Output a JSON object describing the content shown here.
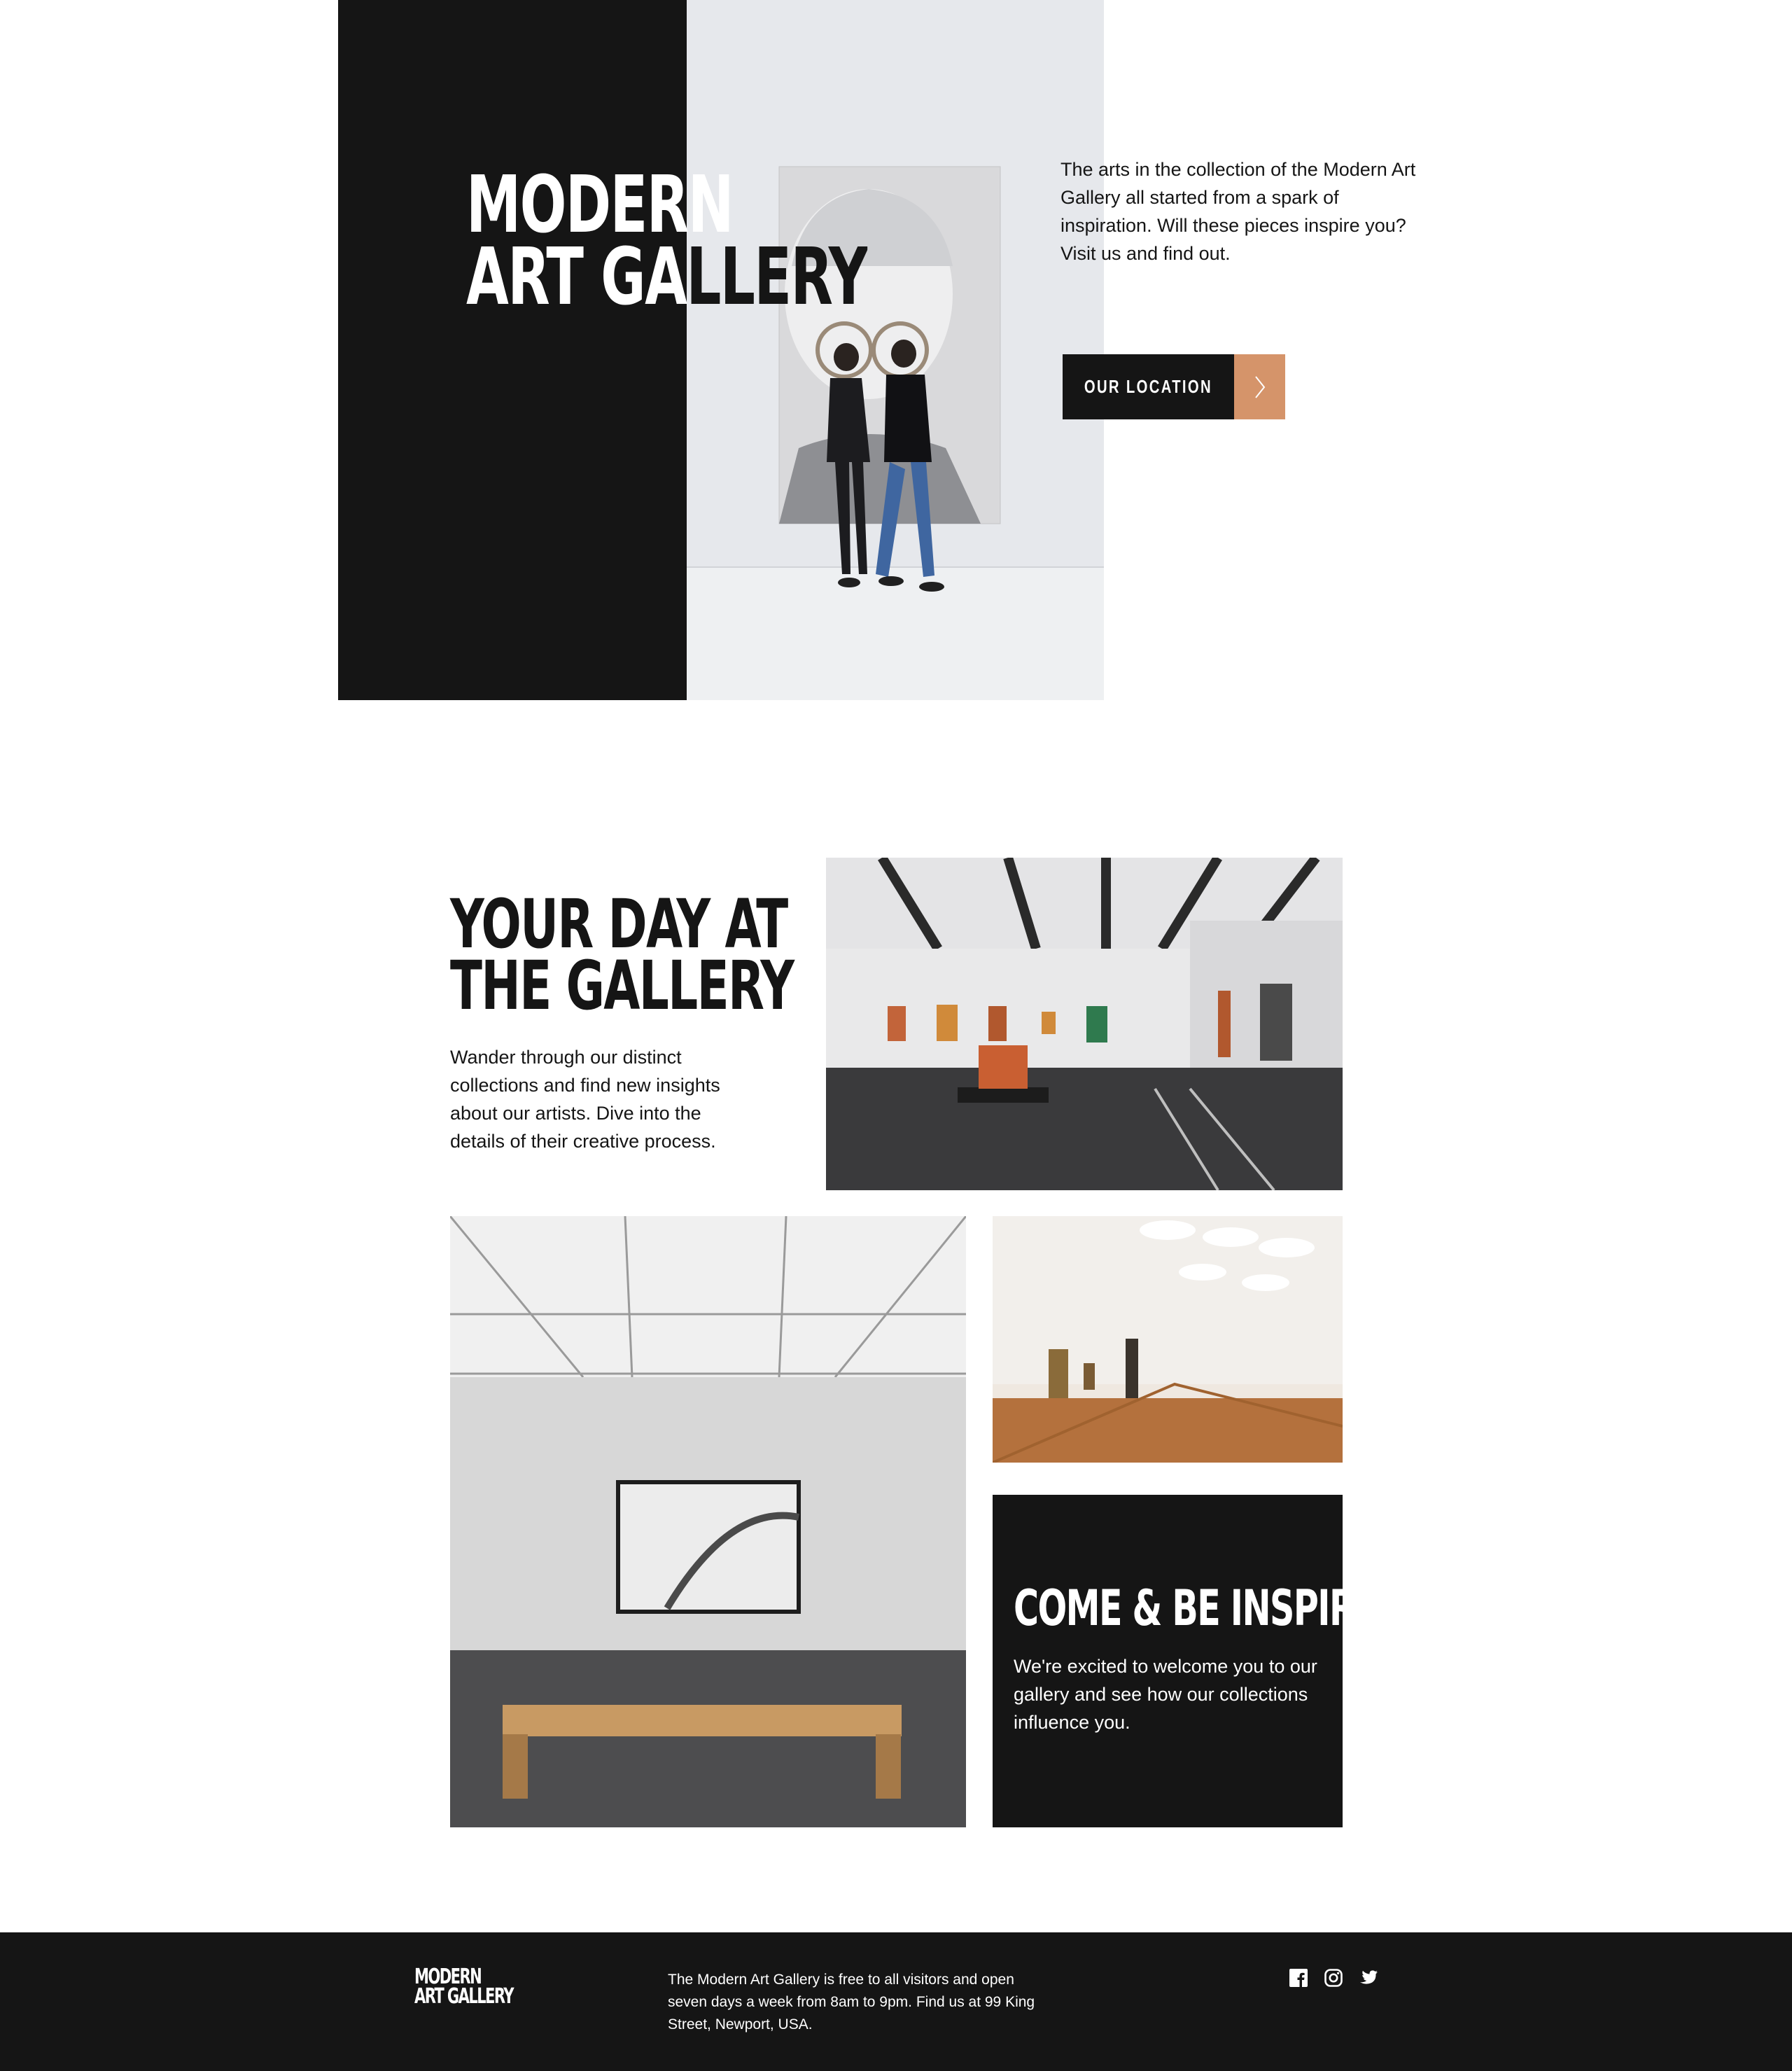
{
  "hero": {
    "title_line1": "MODERN",
    "title_line2": "ART GALLERY",
    "intro": "The arts in the collection of the Modern Art Gallery all started from a spark of inspiration. Will these pieces inspire you? Visit us and find out.",
    "location_button_label": "OUR LOCATION",
    "location_icon": "chevron-right-icon"
  },
  "section": {
    "title_line1": "YOUR DAY AT",
    "title_line2": "THE GALLERY",
    "text": "Wander through our distinct collections and find new insights about our artists. Dive into the details of their creative process."
  },
  "inspired": {
    "title": "COME & BE INSPIRED",
    "text": "We're excited to welcome you to our gallery and see how our collections influence you."
  },
  "footer": {
    "logo_line1": "MODERN",
    "logo_line2": "ART GALLERY",
    "text": "The Modern Art Gallery is free to all visitors and open seven days a week from 8am to 9pm. Find us at 99 King Street, Newport, USA.",
    "social_icons": [
      "facebook-icon",
      "instagram-icon",
      "twitter-icon"
    ]
  },
  "colors": {
    "dark": "#151515",
    "accent": "#d5946a",
    "white": "#ffffff"
  }
}
